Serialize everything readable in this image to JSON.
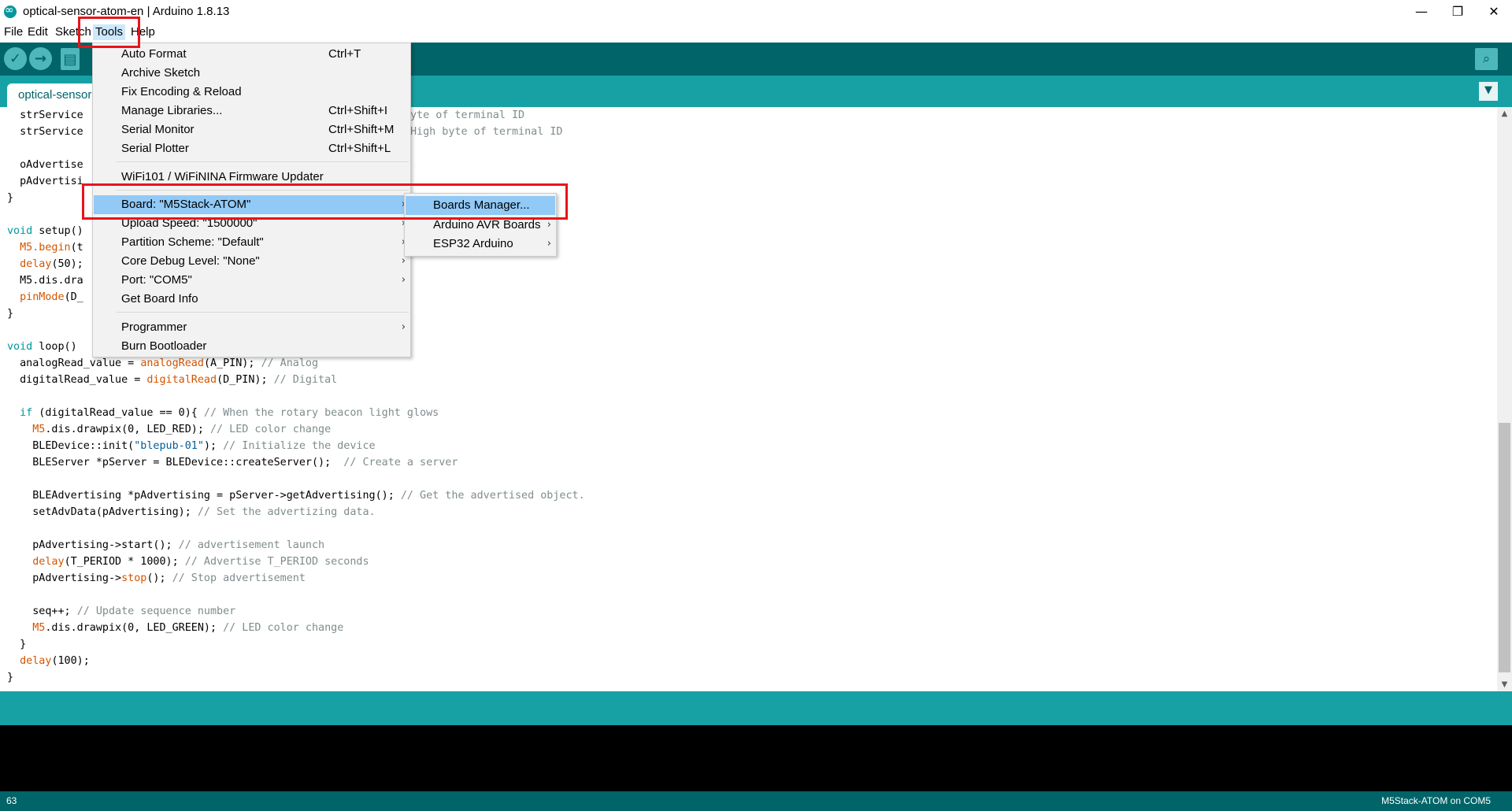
{
  "window": {
    "title": "optical-sensor-atom-en | Arduino 1.8.13",
    "minimize_glyph": "—",
    "maximize_glyph": "❐",
    "close_glyph": "✕"
  },
  "menubar": {
    "file": "File",
    "edit": "Edit",
    "sketch": "Sketch",
    "tools": "Tools",
    "help": "Help"
  },
  "toolbar": {
    "verify_icon": "checkmark-icon",
    "upload_icon": "arrow-right-icon",
    "new_icon": "new-file-icon",
    "serial_monitor_icon": "magnifier-icon"
  },
  "tabs": {
    "active_label": "optical-sensor-atom-en",
    "menu_glyph": "▼"
  },
  "tools_menu": {
    "items": [
      {
        "label": "Auto Format",
        "shortcut": "Ctrl+T"
      },
      {
        "label": "Archive Sketch",
        "shortcut": ""
      },
      {
        "label": "Fix Encoding & Reload",
        "shortcut": ""
      },
      {
        "label": "Manage Libraries...",
        "shortcut": "Ctrl+Shift+I"
      },
      {
        "label": "Serial Monitor",
        "shortcut": "Ctrl+Shift+M"
      },
      {
        "label": "Serial Plotter",
        "shortcut": "Ctrl+Shift+L"
      },
      {
        "label": "WiFi101 / WiFiNINA Firmware Updater",
        "shortcut": ""
      },
      {
        "label": "Board: \"M5Stack-ATOM\"",
        "shortcut": ""
      },
      {
        "label": "Upload Speed: \"1500000\"",
        "shortcut": ""
      },
      {
        "label": "Partition Scheme: \"Default\"",
        "shortcut": ""
      },
      {
        "label": "Core Debug Level: \"None\"",
        "shortcut": ""
      },
      {
        "label": "Port: \"COM5\"",
        "shortcut": ""
      },
      {
        "label": "Get Board Info",
        "shortcut": ""
      },
      {
        "label": "Programmer",
        "shortcut": ""
      },
      {
        "label": "Burn Bootloader",
        "shortcut": ""
      }
    ],
    "submenu_arrow": "›"
  },
  "boards_submenu": {
    "items": [
      {
        "label": "Boards Manager..."
      },
      {
        "label": "Arduino AVR Boards"
      },
      {
        "label": "ESP32 Arduino"
      }
    ]
  },
  "code": {
    "l1a": "  strService",
    "l1b": "yte of terminal ID",
    "l2a": "  strService",
    "l2b": "High byte of terminal ID",
    "l3": "  oAdvertise",
    "l4": "  pAdvertisi",
    "l5": "}",
    "l6a": "void",
    "l6b": " setup()",
    "l7a": "  M5.begin",
    "l7b": "(t",
    "l8a": "  delay",
    "l8b": "(50);",
    "l9a": "  M5.dis.dra",
    "l10a": "  pinMode",
    "l10b": "(D_",
    "l11": "}",
    "l12a": "void",
    "l12b": " loop()",
    "l13a": "  analogRead_value = ",
    "l13b": "analogRead",
    "l13c": "(A_PIN); ",
    "l13d": "// Analog",
    "l14a": "  digitalRead_value = ",
    "l14b": "digitalRead",
    "l14c": "(D_PIN); ",
    "l14d": "// Digital",
    "l15a": "  if",
    "l15b": " (digitalRead_value == 0){ ",
    "l15c": "// When the rotary beacon light glows",
    "l16a": "    M5",
    "l16b": ".dis.drawpix(0, LED_RED); ",
    "l16c": "// LED color change",
    "l17a": "    BLEDevice::init(",
    "l17b": "\"blepub-01\"",
    "l17c": "); ",
    "l17d": "// Initialize the device",
    "l18a": "    BLEServer *pServer = BLEDevice::createServer();  ",
    "l18b": "// Create a server",
    "l19a": "    BLEAdvertising *pAdvertising = pServer->getAdvertising(); ",
    "l19b": "// Get the advertised object.",
    "l20a": "    setAdvData(pAdvertising); ",
    "l20b": "// Set the advertizing data.",
    "l21a": "    pAdvertising->start(); ",
    "l21b": "// advertisement launch",
    "l22a": "    delay",
    "l22b": "(T_PERIOD * 1000); ",
    "l22c": "// Advertise T_PERIOD seconds",
    "l23a": "    pAdvertising->",
    "l23b": "stop",
    "l23c": "(); ",
    "l23d": "// Stop advertisement",
    "l24a": "    seq++; ",
    "l24b": "// Update sequence number",
    "l25a": "    M5",
    "l25b": ".dis.drawpix(0, LED_GREEN); ",
    "l25c": "// LED color change",
    "l26": "  }",
    "l27a": "  delay",
    "l27b": "(100);",
    "l28": "}"
  },
  "scrollbar": {
    "up_glyph": "▲",
    "down_glyph": "▼"
  },
  "footer": {
    "line_number": "63",
    "board_port": "M5Stack-ATOM on COM5"
  },
  "colors": {
    "toolbar": "#006468",
    "tabbar": "#17a1a5",
    "highlight": "#91c9f7",
    "annotation": "#e8141a"
  }
}
